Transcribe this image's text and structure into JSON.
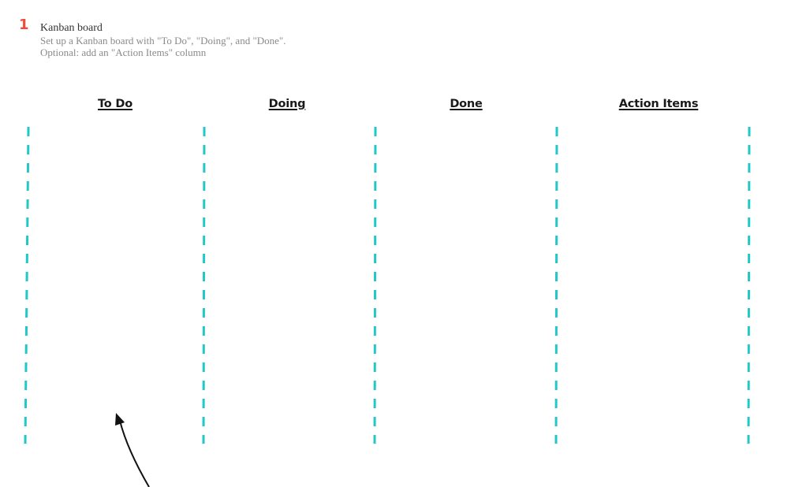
{
  "instruction": {
    "step_number": "1",
    "title": "Kanban board",
    "description_lines": [
      "Set up a Kanban board with \"To Do\", \"Doing\", and \"Done\".",
      "Optional: add an \"Action Items\" column"
    ]
  },
  "board": {
    "columns": [
      {
        "label": "To Do"
      },
      {
        "label": "Doing"
      },
      {
        "label": "Done"
      },
      {
        "label": "Action Items"
      }
    ],
    "divider_color": "#22c7c7",
    "accent_color": "#ee4b3a"
  },
  "annotations": {
    "arrow_icon": "curved-arrow-up"
  }
}
